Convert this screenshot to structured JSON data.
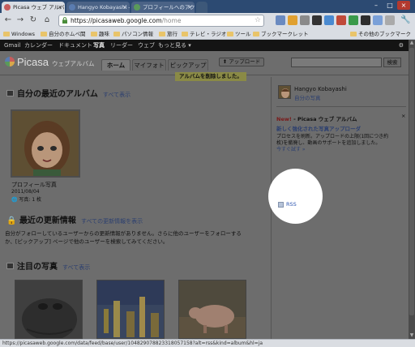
{
  "browser": {
    "tabs": [
      {
        "title": "Picasa ウェブ アルバム - Hang",
        "favicon_color": "#c75c5c",
        "active": true
      },
      {
        "title": "Hangyo Kobayashi - Google",
        "favicon_color": "#5a7cb0",
        "active": false
      },
      {
        "title": "プロフィールへのアクセスとプライ",
        "favicon_color": "#5a9a5a",
        "active": false
      }
    ],
    "tab_close": "×",
    "window_controls": {
      "minimize": "–",
      "maximize": "□",
      "close": "×"
    },
    "url_host": "https://picasaweb.google.com",
    "url_path": "/home",
    "star": "☆",
    "bookmarks": [
      "Windows",
      "自分のホムペ関",
      "趣味",
      "パソコン情報",
      "旅行",
      "テレビ・ラジオ",
      "ツール",
      "ブックマークレット"
    ],
    "other_bookmarks": "その他のブックマーク",
    "status_url": "https://picasaweb.google.com/data/feed/base/user/104829078823318057158?alt=rss&kind=album&hl=ja"
  },
  "gbar": {
    "links": [
      "Gmail",
      "カレンダー",
      "ドキュメント",
      "写真",
      "リーダー",
      "ウェブ",
      "もっと見る ▾"
    ],
    "active_index": 3
  },
  "header": {
    "logo_text": "Picasa",
    "logo_sub": "ウェブアルバム",
    "nav_tabs": [
      "ホーム",
      "マイフォト",
      "ピックアップ"
    ],
    "upload_label": "⬆ アップロード",
    "search_button": "検索",
    "notice": "アルバムを削除しました。"
  },
  "main": {
    "albums_title": "自分の最近のアルバム",
    "albums_link": "すべて表示",
    "album": {
      "name": "プロフィール写真",
      "date": "2011/08/04",
      "count": "写真: 1 枚"
    },
    "updates_title": "最近の更新情報",
    "updates_link": "すべての更新情報を表示",
    "updates_line1": "自分がフォローしているユーザーからの更新情報がありません。さらに他のユーザーをフォローする",
    "updates_line2": "か、[ピックアップ] ページで他のユーザーを検索してみてください。",
    "featured_title": "注目の写真",
    "featured_link": "すべて表示"
  },
  "sidebar": {
    "user_name": "Hangyo Kobayashi",
    "my_photos": "自分の写真",
    "new_badge": "New!",
    "promo_title": "- Picasa ウェブ アルバム",
    "promo_heading": "新しく強化された写真アップローダ",
    "promo_body1": "プロセスを刷新。アップロードの上限(1回につき約",
    "promo_body2": "枚)を撤廃し、動画のサポートを追加しました。",
    "promo_more": "今すぐ試す »",
    "close_x": "×",
    "rss_label": "RSS"
  },
  "scrollbar": {
    "up": "▲",
    "down": "▼"
  }
}
